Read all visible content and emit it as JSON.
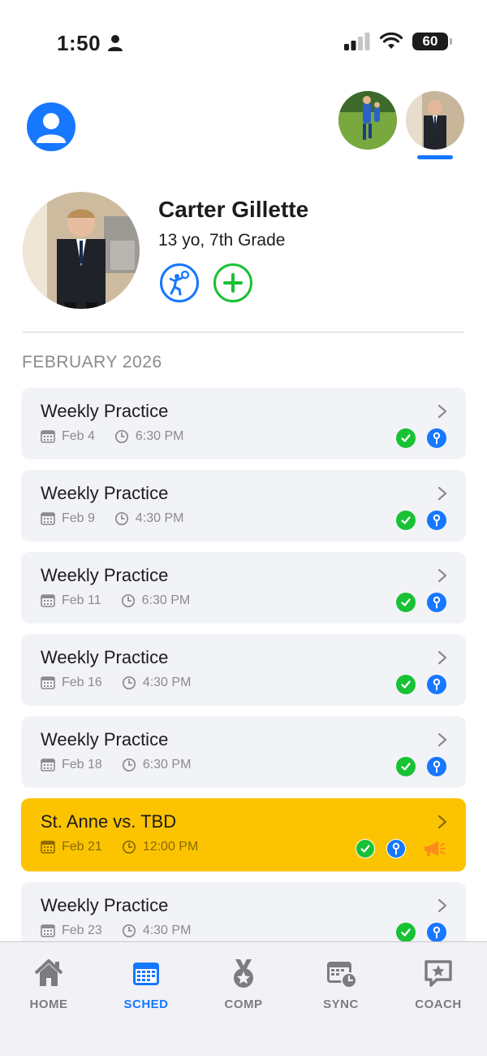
{
  "status_bar": {
    "time": "1:50",
    "battery": "60"
  },
  "profile": {
    "name": "Carter Gillette",
    "subtitle": "13 yo, 7th Grade"
  },
  "schedule": {
    "month": "FEBRUARY 2026",
    "events": [
      {
        "title": "Weekly Practice",
        "date": "Feb 4",
        "time": "6:30 PM",
        "highlight": false,
        "icons": [
          "check-icon",
          "pin-icon"
        ]
      },
      {
        "title": "Weekly Practice",
        "date": "Feb 9",
        "time": "4:30 PM",
        "highlight": false,
        "icons": [
          "check-icon",
          "pin-icon"
        ]
      },
      {
        "title": "Weekly Practice",
        "date": "Feb 11",
        "time": "6:30 PM",
        "highlight": false,
        "icons": [
          "check-icon",
          "pin-icon"
        ]
      },
      {
        "title": "Weekly Practice",
        "date": "Feb 16",
        "time": "4:30 PM",
        "highlight": false,
        "icons": [
          "check-icon",
          "pin-icon"
        ]
      },
      {
        "title": "Weekly Practice",
        "date": "Feb 18",
        "time": "6:30 PM",
        "highlight": false,
        "icons": [
          "check-icon",
          "pin-icon"
        ]
      },
      {
        "title": "St. Anne vs. TBD",
        "date": "Feb 21",
        "time": "12:00 PM",
        "highlight": true,
        "icons": [
          "check-icon",
          "pin-icon",
          "megaphone-icon"
        ]
      },
      {
        "title": "Weekly Practice",
        "date": "Feb 23",
        "time": "4:30 PM",
        "highlight": false,
        "icons": [
          "check-icon",
          "pin-icon"
        ]
      }
    ]
  },
  "tabs": [
    {
      "label": "HOME",
      "icon": "home-icon",
      "active": false
    },
    {
      "label": "SCHED",
      "icon": "calendar-icon",
      "active": true
    },
    {
      "label": "COMP",
      "icon": "medal-icon",
      "active": false
    },
    {
      "label": "SYNC",
      "icon": "calendar-sync-icon",
      "active": false
    },
    {
      "label": "COACH",
      "icon": "coach-chat-icon",
      "active": false
    }
  ],
  "colors": {
    "accent": "#1677ff",
    "success": "#19c135",
    "highlight": "#fcc400",
    "alert": "#ff8a1f"
  }
}
